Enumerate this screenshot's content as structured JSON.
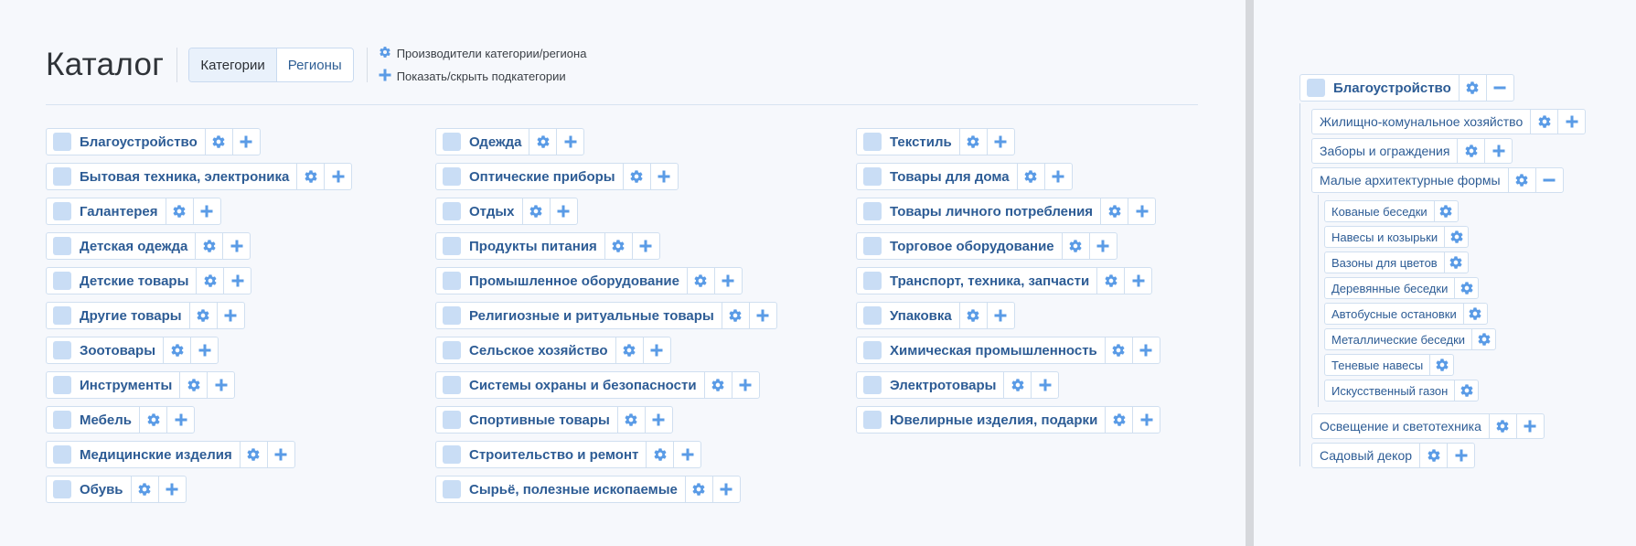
{
  "page": {
    "title": "Каталог",
    "tabs": [
      {
        "label": "Категории",
        "active": true
      },
      {
        "label": "Регионы",
        "active": false
      }
    ],
    "legend": [
      {
        "icon": "gear-icon",
        "text": "Производители категории/региона"
      },
      {
        "icon": "plus-icon",
        "text": "Показать/скрыть подкатегории"
      }
    ]
  },
  "colors": {
    "accent": "#5a9be6",
    "checkbox": "#c9ddf5",
    "label": "#2d5c95",
    "border": "#d0dff0"
  },
  "columns": [
    [
      "Благоустройство",
      "Бытовая техника, электроника",
      "Галантерея",
      "Детская одежда",
      "Детские товары",
      "Другие товары",
      "Зоотовары",
      "Инструменты",
      "Мебель",
      "Медицинские изделия",
      "Обувь"
    ],
    [
      "Одежда",
      "Оптические приборы",
      "Отдых",
      "Продукты питания",
      "Промышленное оборудование",
      "Религиозные и ритуальные товары",
      "Сельское хозяйство",
      "Системы охраны и безопасности",
      "Спортивные товары",
      "Строительство и ремонт",
      "Сырьё, полезные ископаемые"
    ],
    [
      "Текстиль",
      "Товары для дома",
      "Товары личного потребления",
      "Торговое оборудование",
      "Транспорт, техника, запчасти",
      "Упаковка",
      "Химическая промышленность",
      "Электротовары",
      "Ювелирные изделия, подарки"
    ]
  ],
  "tree": {
    "root": {
      "label": "Благоустройство",
      "expanded": true
    },
    "level1": [
      {
        "label": "Жилищно-комунальное хозяйство",
        "expanded": false
      },
      {
        "label": "Заборы и ограждения",
        "expanded": false
      },
      {
        "label": "Малые архитектурные формы",
        "expanded": true
      }
    ],
    "level2": [
      "Кованые беседки",
      "Навесы и козырьки",
      "Вазоны для цветов",
      "Деревянные беседки",
      "Автобусные остановки",
      "Металлические беседки",
      "Теневые навесы",
      "Искусственный газон"
    ],
    "level1_after": [
      {
        "label": "Освещение и светотехника",
        "expanded": false
      },
      {
        "label": "Садовый декор",
        "expanded": false
      }
    ]
  }
}
